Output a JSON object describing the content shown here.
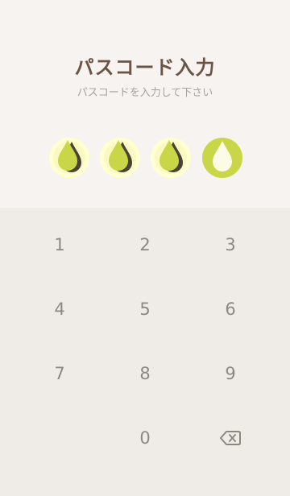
{
  "header": {
    "title": "パスコード入力",
    "subtitle": "パスコードを入力して下さい"
  },
  "passcode": {
    "length": 4,
    "entered_count": 3
  },
  "keypad": {
    "keys": [
      "1",
      "2",
      "3",
      "4",
      "5",
      "6",
      "7",
      "8",
      "9",
      "0"
    ],
    "delete_icon": "backspace-icon"
  },
  "colors": {
    "accent_lime": "#c8d648",
    "glow": "#ffffd0",
    "shadow": "#4a4237",
    "title": "#6b5444",
    "key_text": "#8e8880"
  }
}
